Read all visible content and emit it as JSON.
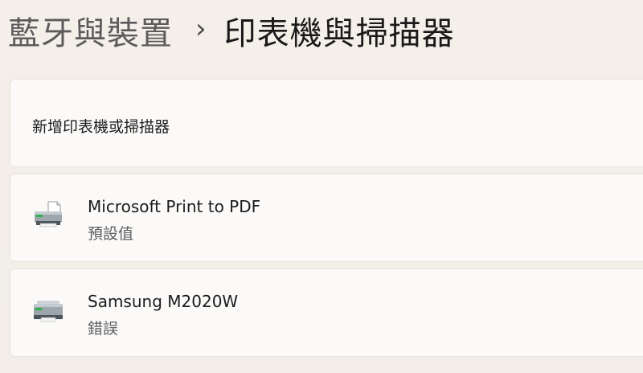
{
  "breadcrumb": {
    "parent": "藍牙與裝置",
    "separator": "›",
    "current": "印表機與掃描器"
  },
  "add_device": {
    "label": "新增印表機或掃描器"
  },
  "printers": [
    {
      "name": "Microsoft Print to PDF",
      "status": "預設值",
      "icon": "pdf-printer-icon"
    },
    {
      "name": "Samsung M2020W",
      "status": "錯誤",
      "icon": "printer-icon"
    }
  ],
  "colors": {
    "background": "#f3eee9",
    "card": "#fbfaf9",
    "secondary_text": "#5e5e5e"
  }
}
